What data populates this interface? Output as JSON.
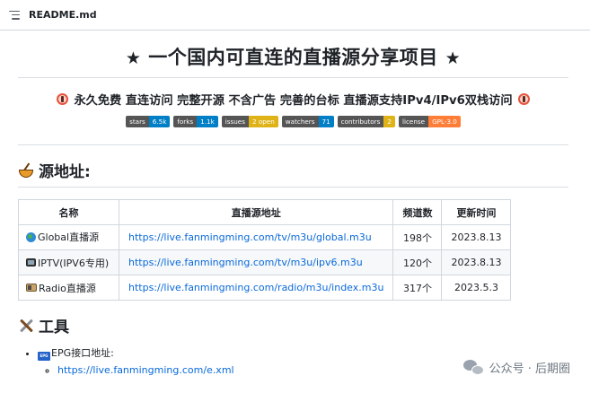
{
  "header": {
    "filename": "README.md"
  },
  "readme": {
    "title_star_left": "★",
    "title_text": "一个国内可直连的直播源分享项目",
    "title_star_right": "★",
    "subtitle": "永久免费 直连访问 完整开源 不含广告 完善的台标 直播源支持IPv4/IPv6双栈访问",
    "badges": [
      {
        "label": "stars",
        "value": "6.5k",
        "color": "#007ec6"
      },
      {
        "label": "forks",
        "value": "1.1k",
        "color": "#007ec6"
      },
      {
        "label": "issues",
        "value": "2 open",
        "color": "#dfb317"
      },
      {
        "label": "watchers",
        "value": "71",
        "color": "#007ec6"
      },
      {
        "label": "contributors",
        "value": "2",
        "color": "#dfb317"
      },
      {
        "label": "license",
        "value": "GPL-3.0",
        "color": "#fe7d37"
      }
    ],
    "sources_heading": "源地址:",
    "table": {
      "headers": [
        "名称",
        "直播源地址",
        "频道数",
        "更新时间"
      ],
      "rows": [
        {
          "icon": "globe-icon",
          "name": "Global直播源",
          "url": "https://live.fanmingming.com/tv/m3u/global.m3u",
          "channels": "198个",
          "updated": "2023.8.13"
        },
        {
          "icon": "tv-icon",
          "name": "IPTV(IPV6专用)",
          "url": "https://live.fanmingming.com/tv/m3u/ipv6.m3u",
          "channels": "120个",
          "updated": "2023.8.13"
        },
        {
          "icon": "radio-icon",
          "name": "Radio直播源",
          "url": "https://live.fanmingming.com/radio/m3u/index.m3u",
          "channels": "317个",
          "updated": "2023.5.3"
        }
      ]
    },
    "tools_heading": "工具",
    "tools": [
      {
        "icon": "epg-icon",
        "label": "EPG接口地址:",
        "link": "https://live.fanmingming.com/e.xml"
      }
    ]
  },
  "watermark": {
    "text": "公众号 · 后期圈"
  }
}
